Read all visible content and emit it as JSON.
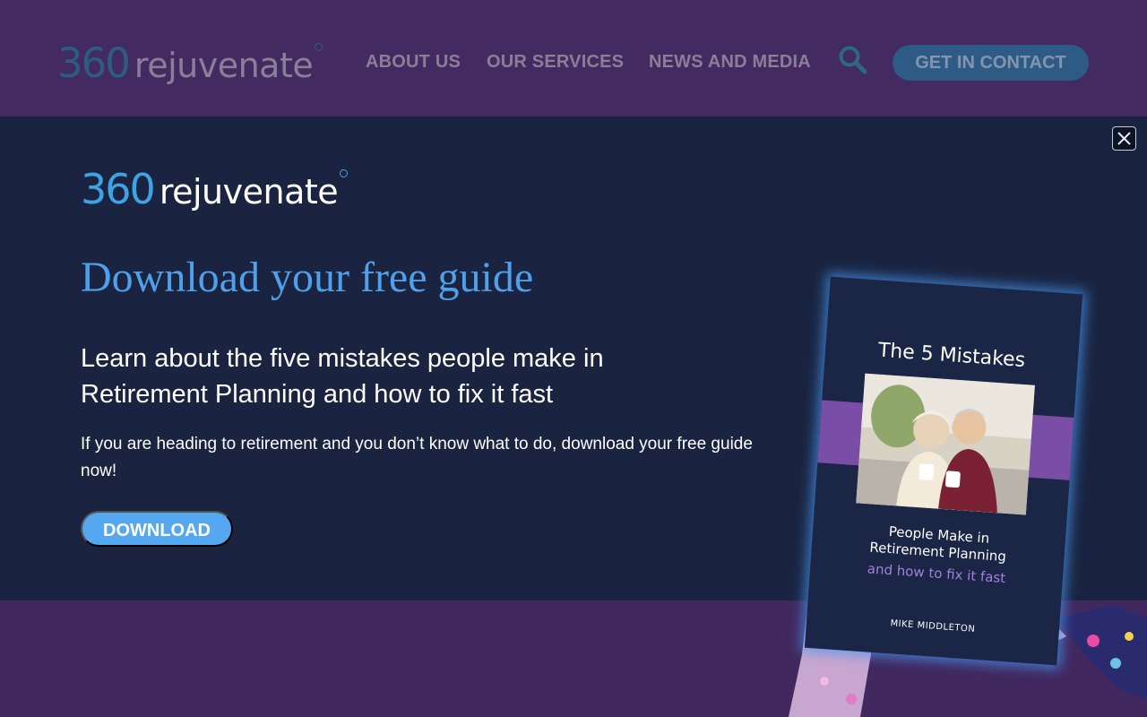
{
  "header": {
    "logo": {
      "number": "360",
      "word": "rejuvenate"
    },
    "nav": [
      {
        "label": "ABOUT US"
      },
      {
        "label": "OUR SERVICES"
      },
      {
        "label": "NEWS AND MEDIA"
      }
    ],
    "search_icon": "search-icon",
    "cta_label": "GET IN CONTACT"
  },
  "modal": {
    "close_icon": "close-icon",
    "logo": {
      "number": "360",
      "word": "rejuvenate"
    },
    "heading": "Download your free guide",
    "subheading": "Learn about the five mistakes people make in Retirement Planning and how to fix it fast",
    "body": "If you are heading to retirement and you don’t know what to do, download your free guide now!",
    "download_label": "DOWNLOAD",
    "book": {
      "title": "The 5 Mistakes",
      "line1": "People Make in",
      "line2": "Retirement Planning",
      "line3": "and how to fix it fast",
      "author": "MIKE MIDDLETON"
    }
  },
  "colors": {
    "header_bg": "#432a60",
    "modal_bg": "#1a2440",
    "accent_blue": "#4fa0ea",
    "button_blue": "#55a7ef",
    "band_purple": "#7a4ea7"
  }
}
